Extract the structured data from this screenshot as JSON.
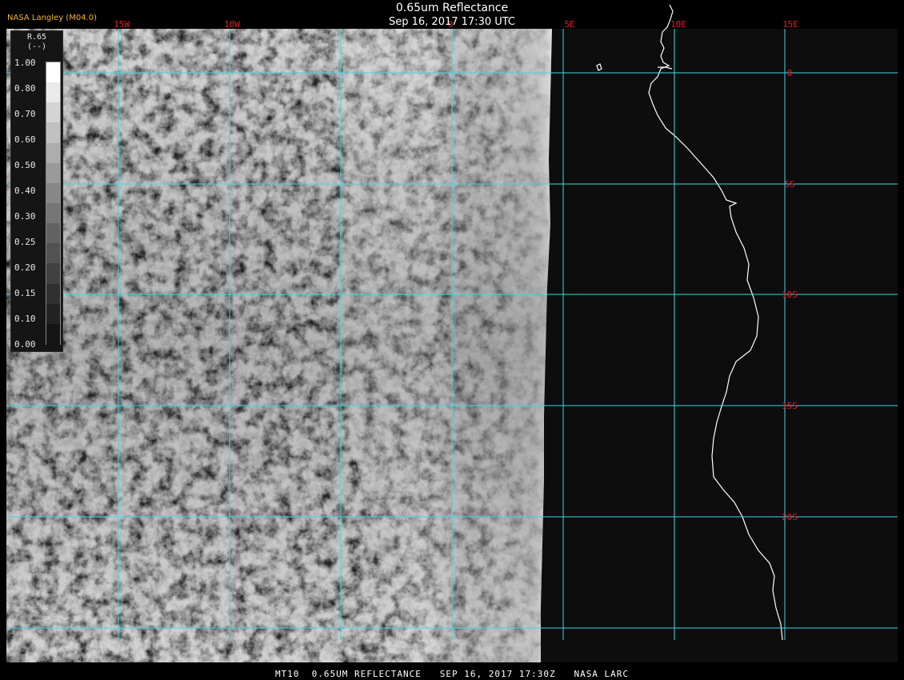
{
  "header": {
    "title": "0.65um Reflectance",
    "datetime": "Sep 16, 2017 17:30 UTC",
    "organization": "NASA Langley (M04.0)"
  },
  "footer": {
    "caption": "MT10  0.65UM REFLECTANCE   SEP 16, 2017 17:30Z   NASA LARC"
  },
  "colorbar": {
    "variable": "R.65",
    "units": "(--)",
    "ticks": [
      "1.00",
      "0.80",
      "0.70",
      "0.60",
      "0.50",
      "0.40",
      "0.30",
      "0.25",
      "0.20",
      "0.15",
      "0.10",
      "0.00"
    ],
    "levels": [
      "#ffffff",
      "#eaeaea",
      "#d4d4d4",
      "#c1c1c1",
      "#adadad",
      "#9a9a9a",
      "#878787",
      "#757575",
      "#636363",
      "#525252",
      "#414141",
      "#303030",
      "#222222",
      "#151515"
    ]
  },
  "grid": {
    "lon_labels": [
      "15W",
      "10W",
      "0",
      "5E",
      "10E",
      "15E"
    ],
    "lat_labels": [
      "0",
      "5S",
      "10S",
      "15S",
      "20S"
    ],
    "line_color": "#3fd6e6",
    "label_color": "#e0202a"
  },
  "colors": {
    "coastline": "#ffffff",
    "background": "#000000"
  }
}
